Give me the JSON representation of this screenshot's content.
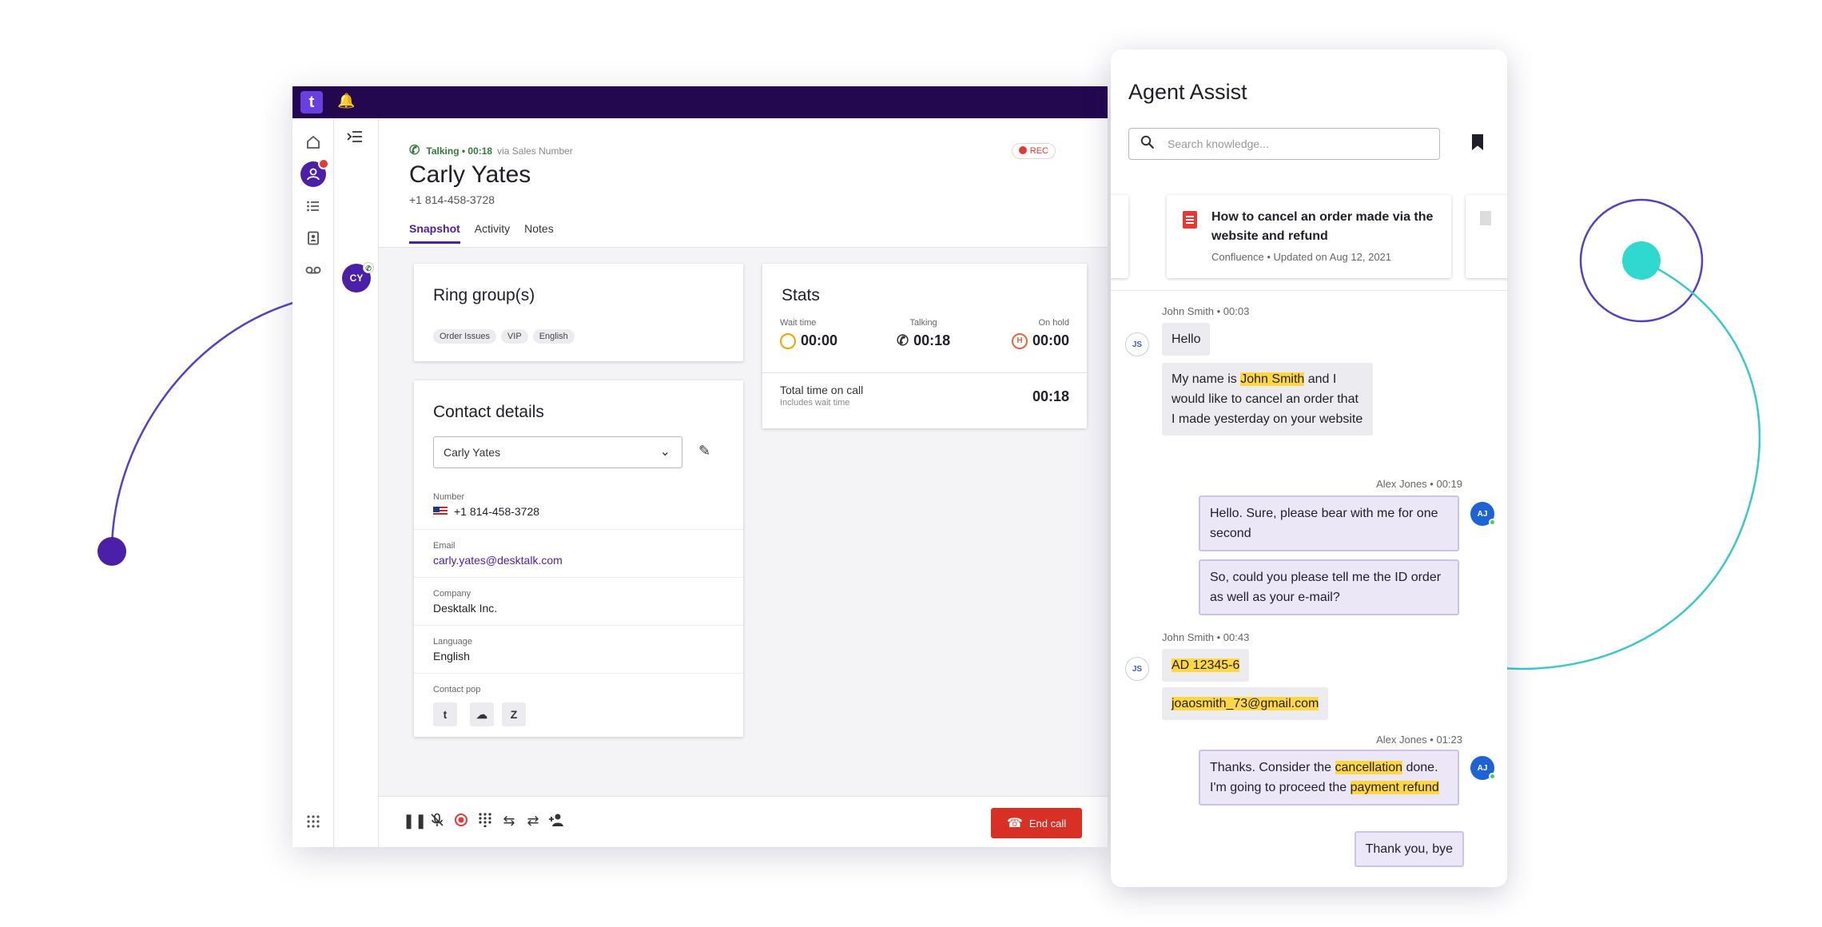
{
  "header": {
    "status": "Talking • 00:18",
    "via": "via Sales Number",
    "contact_name": "Carly Yates",
    "contact_phone": "+1 814-458-3728",
    "rec_label": "REC",
    "avatar_initials": "CY",
    "tabs": [
      {
        "label": "Snapshot",
        "active": true
      },
      {
        "label": "Activity",
        "active": false
      },
      {
        "label": "Notes",
        "active": false
      }
    ]
  },
  "ring_groups": {
    "title": "Ring group(s)",
    "chips": [
      "Order Issues",
      "VIP",
      "English"
    ]
  },
  "stats": {
    "title": "Stats",
    "wait_label": "Wait time",
    "wait_value": "00:00",
    "talking_label": "Talking",
    "talking_value": "00:18",
    "hold_label": "On hold",
    "hold_value": "00:00",
    "total_label": "Total time on call",
    "total_sub": "Includes wait time",
    "total_value": "00:18"
  },
  "contact_details": {
    "title": "Contact details",
    "selected_contact": "Carly Yates",
    "number_label": "Number",
    "number_value": "+1 814-458-3728",
    "email_label": "Email",
    "email_value": "carly.yates@desktalk.com",
    "company_label": "Company",
    "company_value": "Desktalk Inc.",
    "language_label": "Language",
    "language_value": "English",
    "contact_pop_label": "Contact pop"
  },
  "bottom_bar": {
    "end_call_label": "End call"
  },
  "colors": {
    "brand_purple": "#4b1fa8",
    "topbar": "#23084f",
    "highlight": "#ffd740",
    "end_call": "#d93025"
  },
  "assist": {
    "title": "Agent Assist",
    "search_placeholder": "Search knowledge...",
    "kb_card": {
      "title": "How to cancel an order made via the website and refund",
      "meta": "Confluence • Updated on Aug 12, 2021"
    },
    "messages": {
      "h1": "John Smith • 00:03",
      "m1": "Hello",
      "m2_pre": "My name is ",
      "m2_hl": "John Smith",
      "m2_post": " and I would like to cancel an order that I made yesterday on your website",
      "h2": "Alex Jones • 00:19",
      "m3": "Hello. Sure, please bear with me for one second",
      "m4": "So, could you please tell me the ID order as well as your e-mail?",
      "h3": "John Smith • 00:43",
      "m5": "AD 12345-6",
      "m6": "joaosmith_73@gmail.com",
      "h4": "Alex Jones • 01:23",
      "m7_pre": "Thanks. Consider the ",
      "m7_hl1": "cancellation",
      "m7_mid": " done. I'm going to proceed the ",
      "m7_hl2": "payment refund",
      "m8": "Thank you, bye",
      "js_initials": "JS",
      "aj_initials": "AJ"
    }
  }
}
